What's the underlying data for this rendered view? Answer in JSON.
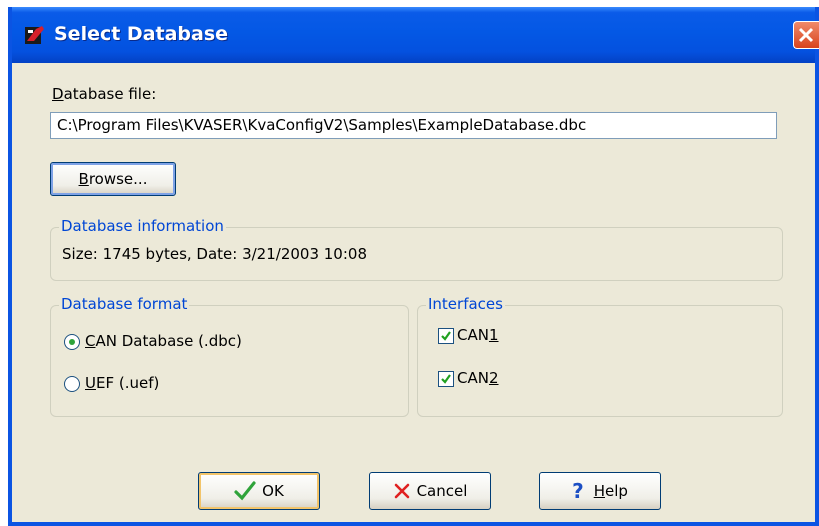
{
  "window": {
    "title": "Select Database"
  },
  "database_file": {
    "label_underlined": "D",
    "label_rest": "atabase file:",
    "value": "C:\\Program Files\\KVASER\\KvaConfigV2\\Samples\\ExampleDatabase.dbc"
  },
  "browse_button": {
    "underlined": "B",
    "rest": "rowse..."
  },
  "database_information": {
    "legend": "Database information",
    "text": "Size: 1745 bytes, Date: 3/21/2003 10:08"
  },
  "database_format": {
    "legend": "Database format",
    "options": [
      {
        "underlined": "C",
        "rest": "AN Database (.dbc)",
        "selected": true
      },
      {
        "underlined": "U",
        "rest": "EF (.uef)",
        "selected": false
      }
    ]
  },
  "interfaces": {
    "legend": "Interfaces",
    "items": [
      {
        "prefix": "CAN",
        "underlined": "1",
        "checked": true
      },
      {
        "prefix": "CAN",
        "underlined": "2",
        "checked": true
      }
    ]
  },
  "buttons": {
    "ok": "OK",
    "cancel": "Cancel",
    "help_underlined": "H",
    "help_rest": "elp"
  },
  "colors": {
    "title_bar": "#0458e5",
    "dialog_bg": "#ece9d8",
    "legend_text": "#0046d5",
    "ok_check": "#2fa33a",
    "cancel_x": "#e02020",
    "help_q": "#1c4fc4"
  }
}
